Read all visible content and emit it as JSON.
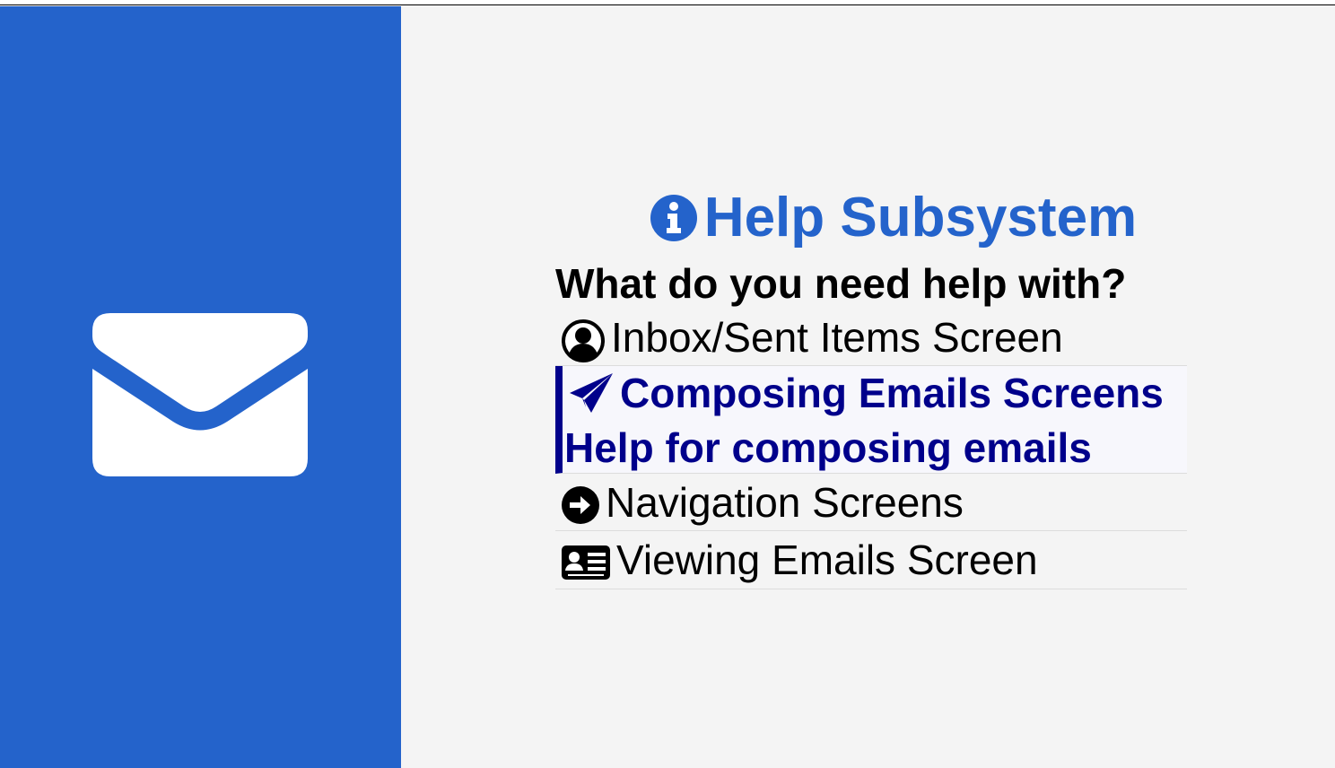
{
  "help": {
    "title": "Help Subsystem",
    "question": "What do you need help with?"
  },
  "menu": {
    "items": [
      {
        "label": "Inbox/Sent Items Screen",
        "icon": "user-circle-icon"
      },
      {
        "label": "Composing Emails Screens",
        "icon": "paper-plane-icon",
        "sublabel": "Help for composing emails",
        "selected": true
      },
      {
        "label": "Navigation Screens",
        "icon": "arrow-circle-right-icon"
      },
      {
        "label": "Viewing Emails Screen",
        "icon": "id-card-icon"
      }
    ]
  },
  "colors": {
    "sidebar": "#2463cb",
    "title": "#2463cb",
    "selected_text": "#00008b",
    "background": "#f4f4f4"
  }
}
